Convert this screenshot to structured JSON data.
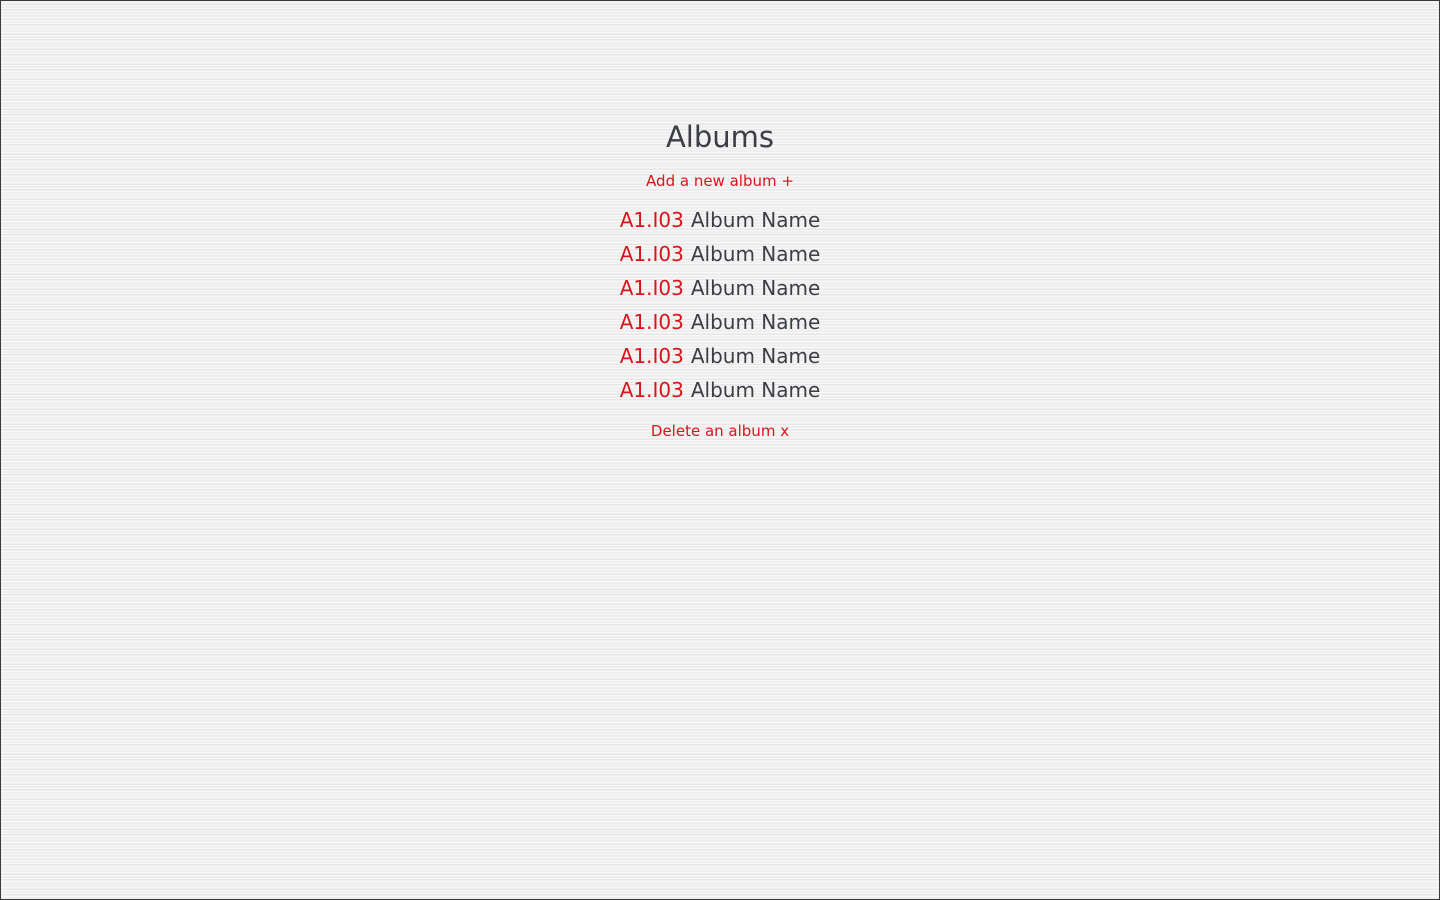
{
  "header": {
    "title": "Albums"
  },
  "actions": {
    "add_label": "Add a new album +",
    "delete_label": "Delete an album x"
  },
  "albums": [
    {
      "code": "A1.I03",
      "name": "Album Name"
    },
    {
      "code": "A1.I03",
      "name": "Album Name"
    },
    {
      "code": "A1.I03",
      "name": "Album Name"
    },
    {
      "code": "A1.I03",
      "name": "Album Name"
    },
    {
      "code": "A1.I03",
      "name": "Album Name"
    },
    {
      "code": "A1.I03",
      "name": "Album Name"
    }
  ],
  "colors": {
    "accent": "#d9141c",
    "text": "#3c3e45",
    "background": "#efefef"
  }
}
